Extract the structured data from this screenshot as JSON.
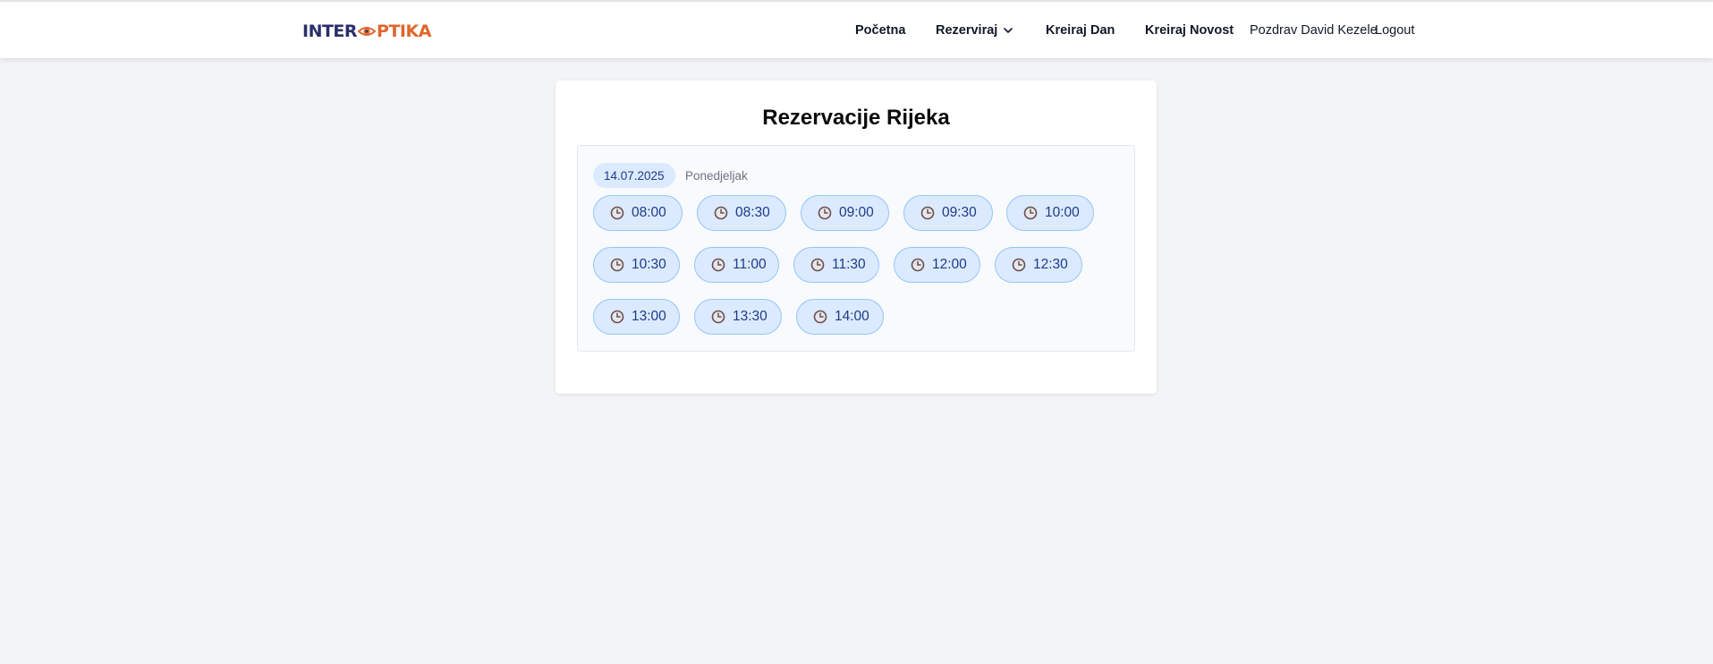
{
  "brand": {
    "logo_part1": "INTER",
    "logo_part2": "PTIKA",
    "logo_text": "INTEROPTIKA",
    "primary_color": "#2b2f6b",
    "accent_color": "#e0662d"
  },
  "nav": {
    "home": "Početna",
    "reserve": "Rezerviraj",
    "create_day": "Kreiraj Dan",
    "create_news": "Kreiraj Novost",
    "greeting": "Pozdrav David Kezele",
    "logout": "Logout"
  },
  "page": {
    "title": "Rezervacije Rijeka"
  },
  "day": {
    "date": "14.07.2025",
    "weekday": "Ponedjeljak",
    "slots": [
      [
        "08:00",
        "08:30",
        "09:00",
        "09:30",
        "10:00"
      ],
      [
        "10:30",
        "11:00",
        "11:30",
        "12:00",
        "12:30"
      ],
      [
        "13:00",
        "13:30",
        "14:00"
      ]
    ]
  },
  "icons": {
    "nav_dropdown": "chevron-down-icon",
    "slot": "clock-icon",
    "logo": "eye-icon"
  },
  "colors": {
    "slot_bg": "#dbeafe",
    "slot_border": "#93c5fd",
    "slot_text": "#1e3a8a",
    "page_bg": "#f3f4f6"
  }
}
